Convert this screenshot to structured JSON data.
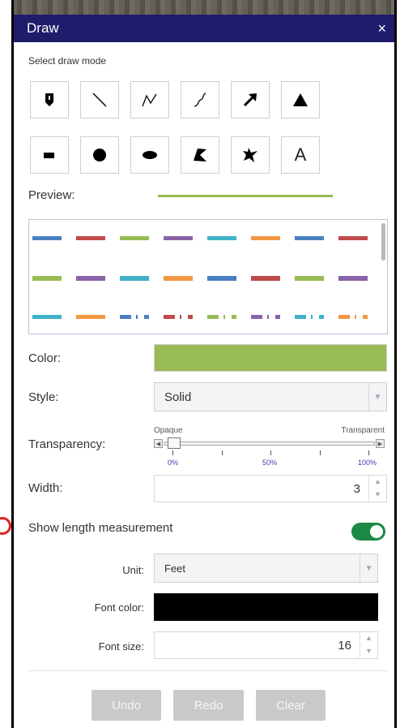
{
  "panel": {
    "title": "Draw",
    "close_glyph": "×",
    "select_mode_label": "Select draw mode",
    "draw_modes": [
      {
        "name": "point-icon"
      },
      {
        "name": "line-icon"
      },
      {
        "name": "polyline-icon"
      },
      {
        "name": "freehand-line-icon"
      },
      {
        "name": "arrow-icon"
      },
      {
        "name": "triangle-icon"
      },
      {
        "name": "rectangle-icon"
      },
      {
        "name": "circle-icon"
      },
      {
        "name": "ellipse-icon"
      },
      {
        "name": "polygon-icon"
      },
      {
        "name": "freehand-polygon-icon"
      },
      {
        "name": "text-icon"
      }
    ],
    "text_tool_glyph": "A",
    "preview_label": "Preview:",
    "preview_color": "#98bb55",
    "style_rows": [
      [
        {
          "c": "#4a7fc1"
        },
        {
          "c": "#c14a4a"
        },
        {
          "c": "#98bb55"
        },
        {
          "c": "#8a63a8"
        },
        {
          "c": "#3fb3c9"
        },
        {
          "c": "#f29743"
        },
        {
          "c": "#4a7fc1"
        },
        {
          "c": "#c14a4a"
        }
      ],
      [
        {
          "c": "#98bb55"
        },
        {
          "c": "#8a63a8"
        },
        {
          "c": "#3fb3c9"
        },
        {
          "c": "#f29743"
        },
        {
          "c": "#4a7fc1"
        },
        {
          "c": "#c14a4a"
        },
        {
          "c": "#98bb55"
        },
        {
          "c": "#8a63a8"
        }
      ],
      [
        {
          "c": "#3fb3c9"
        },
        {
          "c": "#f29743"
        },
        {
          "c": "#4a7fc1"
        },
        {
          "c": "#c14a4a"
        },
        {
          "c": "#98bb55"
        },
        {
          "c": "#8a63a8"
        },
        {
          "c": "#3fb3c9"
        },
        {
          "c": "#f29743"
        }
      ]
    ],
    "color_label": "Color:",
    "color_value": "#98bb55",
    "style_label": "Style:",
    "style_value": "Solid",
    "transparency_label": "Transparency:",
    "transparency_opaque": "Opaque",
    "transparency_transparent": "Transparent",
    "transparency_ticks": [
      "0%",
      "50%",
      "100%"
    ],
    "transparency_value": 0.0,
    "width_label": "Width:",
    "width_value": "3",
    "show_length_label": "Show length measurement",
    "show_length_on": true,
    "unit_label": "Unit:",
    "unit_value": "Feet",
    "font_color_label": "Font color:",
    "font_color_value": "#000000",
    "font_size_label": "Font size:",
    "font_size_value": "16",
    "buttons": {
      "undo": "Undo",
      "redo": "Redo",
      "clear": "Clear"
    }
  }
}
